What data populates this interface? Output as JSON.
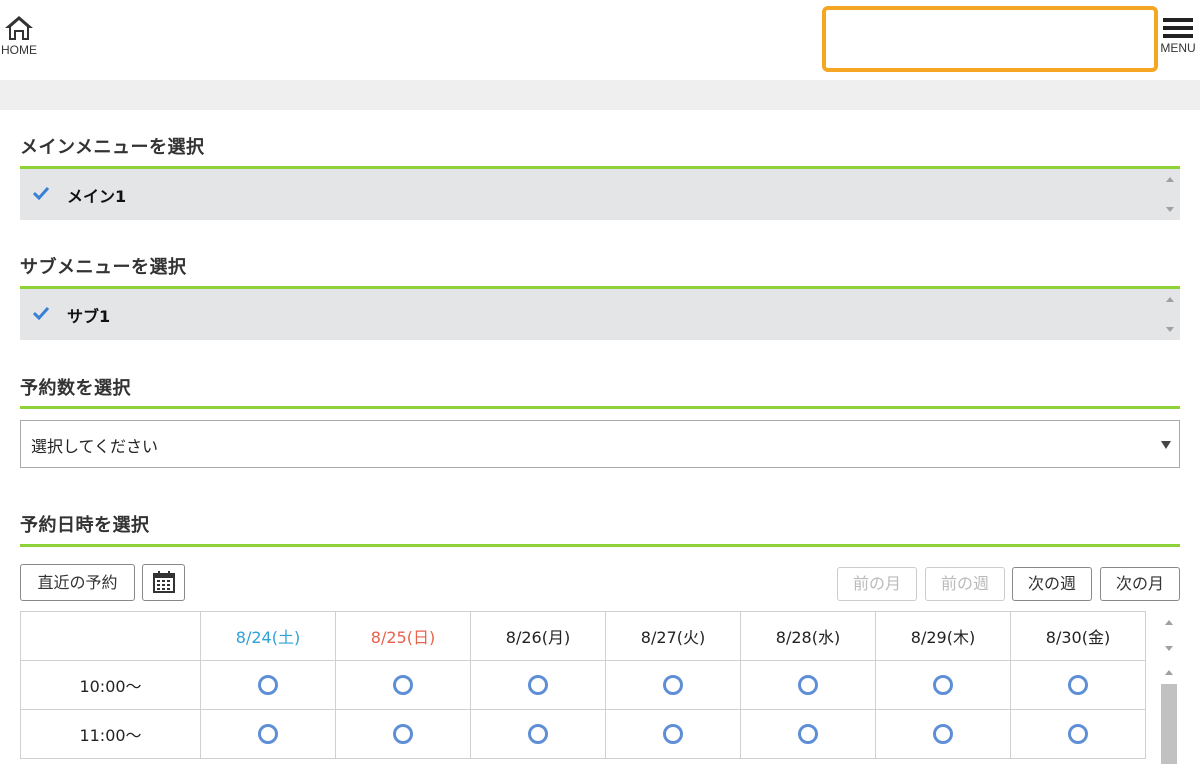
{
  "header": {
    "home_label": "HOME",
    "menu_label": "MENU",
    "search_value": ""
  },
  "sections": {
    "main_menu": {
      "title": "メインメニューを選択",
      "selected": "メイン1"
    },
    "sub_menu": {
      "title": "サブメニューを選択",
      "selected": "サブ1"
    },
    "count": {
      "title": "予約数を選択",
      "placeholder": "選択してください"
    },
    "datetime": {
      "title": "予約日時を選択"
    }
  },
  "calendar_controls": {
    "recent_label": "直近の予約",
    "prev_month": "前の月",
    "prev_week": "前の週",
    "next_week": "次の週",
    "next_month": "次の月"
  },
  "calendar": {
    "days": [
      {
        "label": "8/24(土)",
        "color": "#2ea1d8"
      },
      {
        "label": "8/25(日)",
        "color": "#e8624c"
      },
      {
        "label": "8/26(月)",
        "color": "#222222"
      },
      {
        "label": "8/27(火)",
        "color": "#222222"
      },
      {
        "label": "8/28(水)",
        "color": "#222222"
      },
      {
        "label": "8/29(木)",
        "color": "#222222"
      },
      {
        "label": "8/30(金)",
        "color": "#222222"
      }
    ],
    "rows": [
      {
        "time": "10:00〜",
        "slots": [
          "available",
          "available",
          "available",
          "available",
          "available",
          "available",
          "available"
        ]
      },
      {
        "time": "11:00〜",
        "slots": [
          "available",
          "available",
          "available",
          "available",
          "available",
          "available",
          "available"
        ]
      }
    ]
  },
  "colors": {
    "accent_green": "#8fd138",
    "highlight_orange": "#f5a623",
    "check_blue": "#3a7fd6",
    "slot_circle": "#5e8fd6"
  }
}
